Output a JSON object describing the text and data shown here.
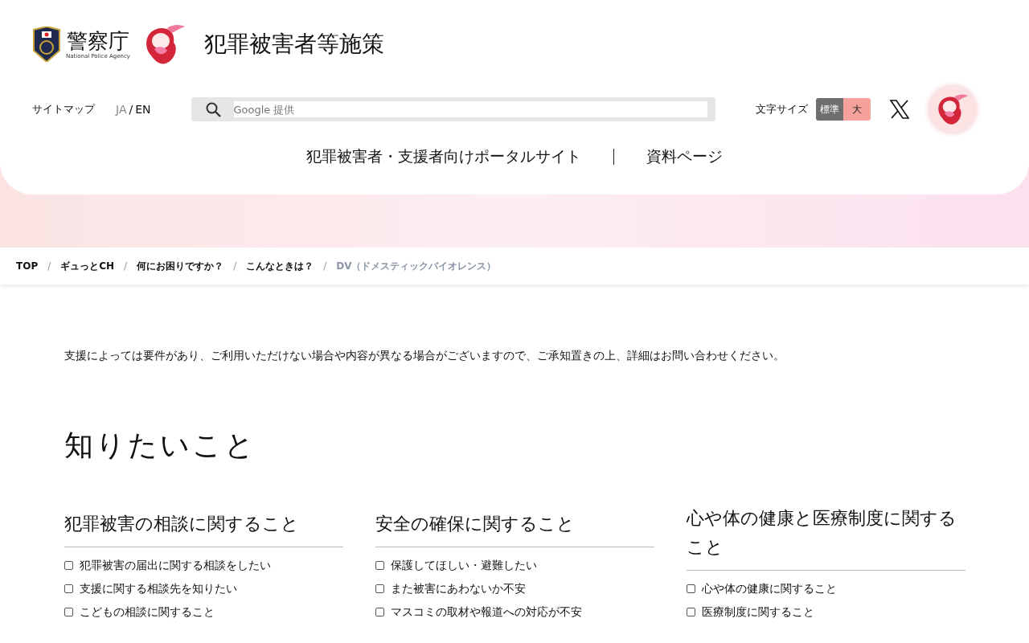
{
  "header": {
    "agency": {
      "name": "警察庁",
      "subtitle": "National Police Agency"
    },
    "site_title": "犯罪被害者等施策",
    "sitemap": "サイトマップ",
    "language_separator": "/",
    "languages": [
      {
        "label": "JA",
        "selected": true
      },
      {
        "label": "EN",
        "selected": false
      }
    ],
    "search": {
      "placeholder": "Google 提供"
    },
    "text_size": {
      "label": "文字サイズ",
      "options": [
        {
          "label": "標準",
          "selected": true
        },
        {
          "label": "大",
          "selected": false
        }
      ]
    },
    "nav": [
      "犯罪被害者・支援者向けポータルサイト",
      "資料ページ"
    ]
  },
  "breadcrumb_separator": "/",
  "breadcrumb": [
    {
      "label": "TOP",
      "current": false
    },
    {
      "label": "ギュっとCH",
      "current": false
    },
    {
      "label": "何にお困りですか？",
      "current": false
    },
    {
      "label": "こんなときは？",
      "current": false
    },
    {
      "label": "DV（ドメスティックバイオレンス）",
      "current": true
    }
  ],
  "notice": "支援によっては要件があり、ご利用いただけない場合や内容が異なる場合がございますので、ご承知置きの上、詳細はお問い合わせください。",
  "section": {
    "heading": "知りたいこと",
    "columns": [
      {
        "heading": "犯罪被害の相談に関すること",
        "items": [
          {
            "label": "犯罪被害の届出に関する相談をしたい",
            "checked": false
          },
          {
            "label": "支援に関する相談先を知りたい",
            "checked": false
          },
          {
            "label": "こどもの相談に関すること",
            "checked": false
          }
        ]
      },
      {
        "heading": "安全の確保に関すること",
        "items": [
          {
            "label": "保護してほしい・避難したい",
            "checked": false
          },
          {
            "label": "また被害にあわないか不安",
            "checked": false
          },
          {
            "label": "マスコミの取材や報道への対応が不安",
            "checked": false
          }
        ]
      },
      {
        "heading": "心や体の健康と医療制度に関すること",
        "items": [
          {
            "label": "心や体の健康に関すること",
            "checked": false
          },
          {
            "label": "医療制度に関すること",
            "checked": false
          }
        ]
      }
    ]
  }
}
